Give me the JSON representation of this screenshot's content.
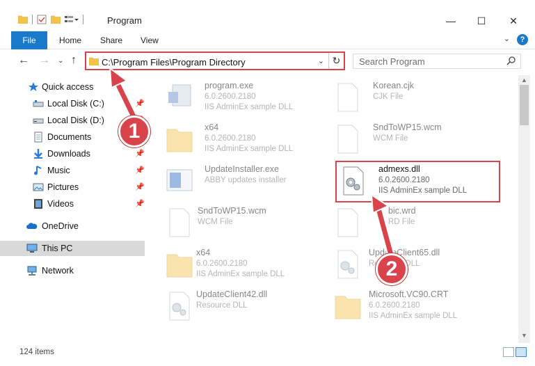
{
  "window": {
    "title": "Program",
    "controls": {
      "minimize": "—",
      "maximize": "☐",
      "close": "✕"
    }
  },
  "ribbon": {
    "file_tab": "File",
    "tabs": [
      "Home",
      "Share",
      "View"
    ],
    "help": "?"
  },
  "address": {
    "path": "C:\\Program Files\\Program Directory",
    "search_placeholder": "Search Program"
  },
  "sidebar": {
    "items": [
      {
        "label": "Quick access",
        "icon": "star-icon",
        "pinned": false
      },
      {
        "label": "Local Disk (C:)",
        "icon": "drive-icon",
        "pinned": true
      },
      {
        "label": "Local Disk (D:)",
        "icon": "drive-icon",
        "pinned": true
      },
      {
        "label": "Documents",
        "icon": "documents-icon",
        "pinned": true
      },
      {
        "label": "Downloads",
        "icon": "downloads-icon",
        "pinned": true
      },
      {
        "label": "Music",
        "icon": "music-icon",
        "pinned": true
      },
      {
        "label": "Pictures",
        "icon": "pictures-icon",
        "pinned": true
      },
      {
        "label": "Videos",
        "icon": "videos-icon",
        "pinned": true
      },
      {
        "label": "OneDrive",
        "icon": "cloud-icon",
        "pinned": false
      },
      {
        "label": "This PC",
        "icon": "computer-icon",
        "pinned": false,
        "selected": true
      },
      {
        "label": "Network",
        "icon": "network-icon",
        "pinned": false
      }
    ]
  },
  "files": [
    {
      "name": "program.exe",
      "line2": "6.0.2600.2180",
      "line3": "IIS AdminEx sample DLL",
      "icon": "exe-icon"
    },
    {
      "name": "Korean.cjk",
      "line2": "CJK File",
      "line3": "",
      "icon": "blank-file-icon"
    },
    {
      "name": "x64",
      "line2": "6.0.2600.2180",
      "line3": "IIS AdminEx sample DLL",
      "icon": "folder-icon"
    },
    {
      "name": "SndToWP15.wcm",
      "line2": "WCM File",
      "line3": "",
      "icon": "blank-file-icon"
    },
    {
      "name": "UpdateInstaller.exe",
      "line2": "ABBY updates installer",
      "line3": "",
      "icon": "installer-icon"
    },
    {
      "name": "admexs.dll",
      "line2": "6.0.2600.2180",
      "line3": "IIS AdminEx sample DLL",
      "icon": "dll-gear-icon"
    },
    {
      "name": "SndToWP15.wcm",
      "line2": "WCM File",
      "line3": "",
      "icon": "blank-file-icon"
    },
    {
      "name": "bic.wrd",
      "line2": "RD File",
      "line3": "",
      "icon": "blank-file-icon"
    },
    {
      "name": "x64",
      "line2": "6.0.2600.2180",
      "line3": "IIS AdminEx sample DLL",
      "icon": "folder-icon"
    },
    {
      "name": "UpdateClient65.dll",
      "line2": "Resource DLL",
      "line3": "",
      "icon": "dll-gear-icon"
    },
    {
      "name": "UpdateClient42.dll",
      "line2": "Resource DLL",
      "line3": "",
      "icon": "dll-gear-icon"
    },
    {
      "name": "Microsoft.VC90.CRT",
      "line2": "6.0.2600.2180",
      "line3": "IIS AdminEx sample DLL",
      "icon": "folder-icon"
    }
  ],
  "status": {
    "item_count": "124 items"
  },
  "annotations": {
    "badge1": "1",
    "badge2": "2"
  },
  "colors": {
    "accent": "#1979ca",
    "annotation": "#d9434c",
    "selected": "#d9d9d9"
  }
}
